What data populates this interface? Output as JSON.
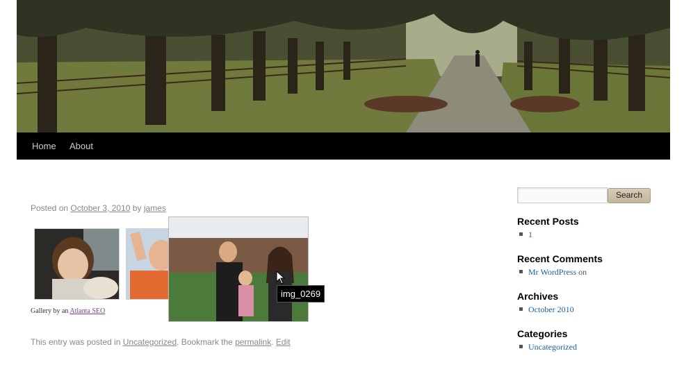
{
  "header": {
    "image": "tree-lined-avenue-header-image"
  },
  "nav": {
    "items": [
      "Home",
      "About"
    ]
  },
  "post": {
    "posted_on": "Posted on",
    "date": "October 3, 2010",
    "by": "by",
    "author": "james",
    "gallery_credit_prefix": "Gallery by an",
    "gallery_credit_link": "Atlanta SEO",
    "tooltip": "img_0269",
    "entry_prefix": "This entry was posted in",
    "category": "Uncategorized",
    "bookmark_text": ". Bookmark the",
    "permalink": "permalink",
    "period": ".",
    "edit": "Edit"
  },
  "sidebar": {
    "search_placeholder": "",
    "search_button": "Search",
    "recent_posts_title": "Recent Posts",
    "recent_posts": [
      "1"
    ],
    "recent_comments_title": "Recent Comments",
    "recent_comment_author": "Mr WordPress",
    "recent_comment_on": "on",
    "archives_title": "Archives",
    "archives": [
      "October 2010"
    ],
    "categories_title": "Categories",
    "categories": [
      "Uncategorized"
    ]
  },
  "colors": {
    "link_blue": "#1b5e9a",
    "nav_bg": "#000000",
    "visited_purple": "#7b3f91"
  }
}
